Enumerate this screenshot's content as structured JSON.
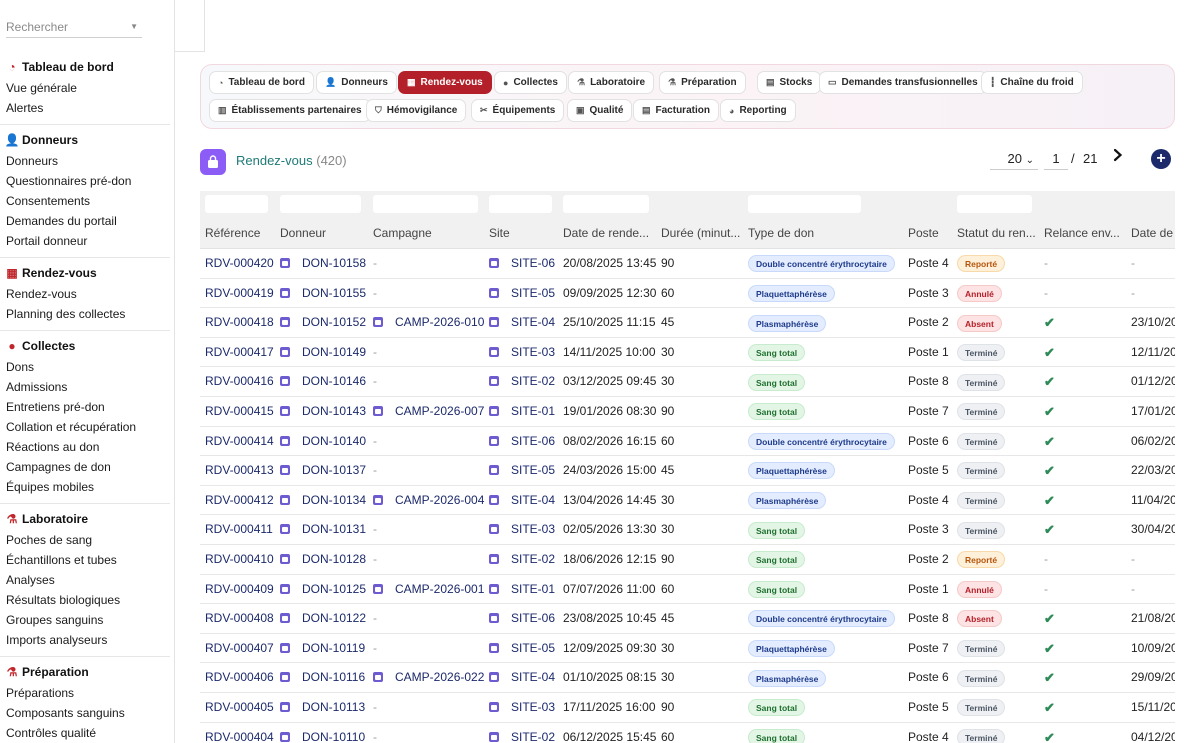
{
  "sidebar": {
    "search_placeholder": "Rechercher",
    "sections": [
      {
        "title": "Tableau de bord",
        "icon": "gauge-icon",
        "items": [
          "Vue générale",
          "Alertes"
        ]
      },
      {
        "title": "Donneurs",
        "icon": "user-icon",
        "items": [
          "Donneurs",
          "Questionnaires pré-don",
          "Consentements",
          "Demandes du portail",
          "Portail donneur"
        ]
      },
      {
        "title": "Rendez-vous",
        "icon": "calendar-icon",
        "items": [
          "Rendez-vous",
          "Planning des collectes"
        ]
      },
      {
        "title": "Collectes",
        "icon": "drop-icon",
        "items": [
          "Dons",
          "Admissions",
          "Entretiens pré-don",
          "Collation et récupération",
          "Réactions au don",
          "Campagnes de don",
          "Équipes mobiles"
        ]
      },
      {
        "title": "Laboratoire",
        "icon": "flask-icon",
        "items": [
          "Poches de sang",
          "Échantillons et tubes",
          "Analyses",
          "Résultats biologiques",
          "Groupes sanguins",
          "Imports analyseurs"
        ]
      },
      {
        "title": "Préparation",
        "icon": "beaker-icon",
        "items": [
          "Préparations",
          "Composants sanguins",
          "Contrôles qualité"
        ]
      }
    ]
  },
  "tabs": [
    {
      "label": "Tableau de bord",
      "icon": "gauge-icon",
      "active": false
    },
    {
      "label": "Donneurs",
      "icon": "user-icon",
      "active": false
    },
    {
      "label": "Rendez-vous",
      "icon": "calendar-icon",
      "active": true
    },
    {
      "label": "Collectes",
      "icon": "drop-icon",
      "active": false
    },
    {
      "label": "Laboratoire",
      "icon": "flask-icon",
      "active": false
    },
    {
      "label": "Préparation",
      "icon": "beaker-icon",
      "active": false
    },
    {
      "label": "Stocks",
      "icon": "warehouse-icon",
      "active": false
    },
    {
      "label": "Demandes transfusionnelles",
      "icon": "document-icon",
      "active": false
    },
    {
      "label": "Chaîne du froid",
      "icon": "thermometer-icon",
      "active": false
    },
    {
      "label": "Établissements partenaires",
      "icon": "building-icon",
      "active": false
    },
    {
      "label": "Hémovigilance",
      "icon": "shield-icon",
      "active": false
    },
    {
      "label": "Équipements",
      "icon": "tools-icon",
      "active": false
    },
    {
      "label": "Qualité",
      "icon": "clipboard-icon",
      "active": false
    },
    {
      "label": "Facturation",
      "icon": "invoice-icon",
      "active": false
    },
    {
      "label": "Reporting",
      "icon": "chart-icon",
      "active": false
    }
  ],
  "list": {
    "title": "Rendez-vous",
    "count": "(420)",
    "page_size": "20",
    "page": "1",
    "page_sep": "/",
    "page_total": "21"
  },
  "columns": [
    "Référence",
    "Donneur",
    "Campagne",
    "Site",
    "Date de rende...",
    "Durée (minut...",
    "Type de don",
    "Poste",
    "Statut du ren...",
    "Relance env...",
    "Date de r"
  ],
  "rows": [
    {
      "ref": "RDV-000420",
      "donor": "DON-10158",
      "campaign": "-",
      "site": "SITE-06",
      "date": "20/08/2025 13:45",
      "duration": "90",
      "type": "Double concentré érythrocytaire",
      "type_color": "blue",
      "post": "Poste 4",
      "status": "Reporté",
      "status_color": "orange",
      "reminder": "-",
      "rdate": "-"
    },
    {
      "ref": "RDV-000419",
      "donor": "DON-10155",
      "campaign": "-",
      "site": "SITE-05",
      "date": "09/09/2025 12:30",
      "duration": "60",
      "type": "Plaquettaphérèse",
      "type_color": "blue",
      "post": "Poste 3",
      "status": "Annulé",
      "status_color": "red",
      "reminder": "-",
      "rdate": "-"
    },
    {
      "ref": "RDV-000418",
      "donor": "DON-10152",
      "campaign": "CAMP-2026-010",
      "site": "SITE-04",
      "date": "25/10/2025 11:15",
      "duration": "45",
      "type": "Plasmaphérèse",
      "type_color": "blue",
      "post": "Poste 2",
      "status": "Absent",
      "status_color": "red",
      "reminder": "✔",
      "rdate": "23/10/20"
    },
    {
      "ref": "RDV-000417",
      "donor": "DON-10149",
      "campaign": "-",
      "site": "SITE-03",
      "date": "14/11/2025 10:00",
      "duration": "30",
      "type": "Sang total",
      "type_color": "green",
      "post": "Poste 1",
      "status": "Terminé",
      "status_color": "grey",
      "reminder": "✔",
      "rdate": "12/11/20"
    },
    {
      "ref": "RDV-000416",
      "donor": "DON-10146",
      "campaign": "-",
      "site": "SITE-02",
      "date": "03/12/2025 09:45",
      "duration": "30",
      "type": "Sang total",
      "type_color": "green",
      "post": "Poste 8",
      "status": "Terminé",
      "status_color": "grey",
      "reminder": "✔",
      "rdate": "01/12/20"
    },
    {
      "ref": "RDV-000415",
      "donor": "DON-10143",
      "campaign": "CAMP-2026-007",
      "site": "SITE-01",
      "date": "19/01/2026 08:30",
      "duration": "90",
      "type": "Sang total",
      "type_color": "green",
      "post": "Poste 7",
      "status": "Terminé",
      "status_color": "grey",
      "reminder": "✔",
      "rdate": "17/01/20"
    },
    {
      "ref": "RDV-000414",
      "donor": "DON-10140",
      "campaign": "-",
      "site": "SITE-06",
      "date": "08/02/2026 16:15",
      "duration": "60",
      "type": "Double concentré érythrocytaire",
      "type_color": "blue",
      "post": "Poste 6",
      "status": "Terminé",
      "status_color": "grey",
      "reminder": "✔",
      "rdate": "06/02/20"
    },
    {
      "ref": "RDV-000413",
      "donor": "DON-10137",
      "campaign": "-",
      "site": "SITE-05",
      "date": "24/03/2026 15:00",
      "duration": "45",
      "type": "Plaquettaphérèse",
      "type_color": "blue",
      "post": "Poste 5",
      "status": "Terminé",
      "status_color": "grey",
      "reminder": "✔",
      "rdate": "22/03/20"
    },
    {
      "ref": "RDV-000412",
      "donor": "DON-10134",
      "campaign": "CAMP-2026-004",
      "site": "SITE-04",
      "date": "13/04/2026 14:45",
      "duration": "30",
      "type": "Plasmaphérèse",
      "type_color": "blue",
      "post": "Poste 4",
      "status": "Terminé",
      "status_color": "grey",
      "reminder": "✔",
      "rdate": "11/04/20"
    },
    {
      "ref": "RDV-000411",
      "donor": "DON-10131",
      "campaign": "-",
      "site": "SITE-03",
      "date": "02/05/2026 13:30",
      "duration": "30",
      "type": "Sang total",
      "type_color": "green",
      "post": "Poste 3",
      "status": "Terminé",
      "status_color": "grey",
      "reminder": "✔",
      "rdate": "30/04/20"
    },
    {
      "ref": "RDV-000410",
      "donor": "DON-10128",
      "campaign": "-",
      "site": "SITE-02",
      "date": "18/06/2026 12:15",
      "duration": "90",
      "type": "Sang total",
      "type_color": "green",
      "post": "Poste 2",
      "status": "Reporté",
      "status_color": "orange",
      "reminder": "-",
      "rdate": "-"
    },
    {
      "ref": "RDV-000409",
      "donor": "DON-10125",
      "campaign": "CAMP-2026-001",
      "site": "SITE-01",
      "date": "07/07/2026 11:00",
      "duration": "60",
      "type": "Sang total",
      "type_color": "green",
      "post": "Poste 1",
      "status": "Annulé",
      "status_color": "red",
      "reminder": "-",
      "rdate": "-"
    },
    {
      "ref": "RDV-000408",
      "donor": "DON-10122",
      "campaign": "-",
      "site": "SITE-06",
      "date": "23/08/2025 10:45",
      "duration": "45",
      "type": "Double concentré érythrocytaire",
      "type_color": "blue",
      "post": "Poste 8",
      "status": "Absent",
      "status_color": "red",
      "reminder": "✔",
      "rdate": "21/08/20"
    },
    {
      "ref": "RDV-000407",
      "donor": "DON-10119",
      "campaign": "-",
      "site": "SITE-05",
      "date": "12/09/2025 09:30",
      "duration": "30",
      "type": "Plaquettaphérèse",
      "type_color": "blue",
      "post": "Poste 7",
      "status": "Terminé",
      "status_color": "grey",
      "reminder": "✔",
      "rdate": "10/09/20"
    },
    {
      "ref": "RDV-000406",
      "donor": "DON-10116",
      "campaign": "CAMP-2026-022",
      "site": "SITE-04",
      "date": "01/10/2025 08:15",
      "duration": "30",
      "type": "Plasmaphérèse",
      "type_color": "blue",
      "post": "Poste 6",
      "status": "Terminé",
      "status_color": "grey",
      "reminder": "✔",
      "rdate": "29/09/20"
    },
    {
      "ref": "RDV-000405",
      "donor": "DON-10113",
      "campaign": "-",
      "site": "SITE-03",
      "date": "17/11/2025 16:00",
      "duration": "90",
      "type": "Sang total",
      "type_color": "green",
      "post": "Poste 5",
      "status": "Terminé",
      "status_color": "grey",
      "reminder": "✔",
      "rdate": "15/11/20"
    },
    {
      "ref": "RDV-000404",
      "donor": "DON-10110",
      "campaign": "-",
      "site": "SITE-02",
      "date": "06/12/2025 15:45",
      "duration": "60",
      "type": "Sang total",
      "type_color": "green",
      "post": "Poste 4",
      "status": "Terminé",
      "status_color": "grey",
      "reminder": "✔",
      "rdate": "04/12/20"
    }
  ],
  "colors": {
    "accent": "#b3202a",
    "link": "#1c2a6b",
    "title": "#1f7a78",
    "list_icon": "#8b5cf6",
    "check": "#2e8b57"
  }
}
